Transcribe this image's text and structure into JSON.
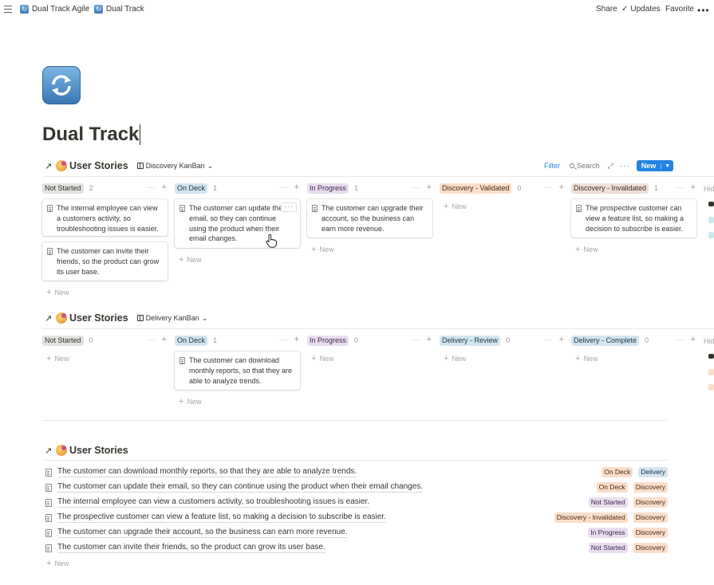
{
  "topbar": {
    "breadcrumb": [
      "Dual Track Agile",
      "Dual Track"
    ],
    "separator": "/",
    "share": "Share",
    "updates": "Updates",
    "favorite": "Favorite",
    "more": "•••"
  },
  "page": {
    "icon": "repeat-arrows-icon",
    "title": "Dual Track"
  },
  "discovery_board": {
    "section_title": "User Stories",
    "view_name": "Discovery KanBan",
    "toolbar": {
      "filter": "Filter",
      "search": "Search",
      "new": "New"
    },
    "columns": [
      {
        "label": "Not Started",
        "count": "2",
        "color": "gray",
        "cards": [
          "The internal employee can view a customers activity, so troubleshooting issues is easier.",
          "The customer can invite their friends, so the product can grow its user base."
        ]
      },
      {
        "label": "On Deck",
        "count": "1",
        "color": "blue",
        "cards": [
          "The customer can update their email, so they can continue using the product when their email changes."
        ]
      },
      {
        "label": "In Progress",
        "count": "1",
        "color": "purple",
        "cards": [
          "The customer can upgrade their account, so the business can earn more revenue."
        ]
      },
      {
        "label": "Discovery - Validated",
        "count": "0",
        "color": "orange",
        "cards": []
      },
      {
        "label": "Discovery - Invalidated",
        "count": "1",
        "color": "brown",
        "cards": [
          "The prospective customer can view a feature list, so making a decision to subscribe is easier."
        ]
      }
    ],
    "hidden_label": "Hid",
    "new_label": "New"
  },
  "delivery_board": {
    "section_title": "User Stories",
    "view_name": "Delivery KanBan",
    "columns": [
      {
        "label": "Not Started",
        "count": "0",
        "color": "gray",
        "cards": []
      },
      {
        "label": "On Deck",
        "count": "1",
        "color": "blue",
        "cards": [
          "The customer can download monthly reports, so that they are able to analyze trends."
        ]
      },
      {
        "label": "In Progress",
        "count": "0",
        "color": "purple",
        "cards": []
      },
      {
        "label": "Delivery - Review",
        "count": "0",
        "color": "blue",
        "cards": []
      },
      {
        "label": "Delivery - Complete",
        "count": "0",
        "color": "blue",
        "cards": []
      }
    ],
    "new_label": "New"
  },
  "list_view": {
    "section_title": "User Stories",
    "rows": [
      {
        "title": "The customer can download monthly reports, so that they are able to analyze trends.",
        "status": "On Deck",
        "status_color": "blue",
        "track": "Delivery",
        "track_color": "blue"
      },
      {
        "title": "The customer can update their email, so they can continue using the product when their email changes.",
        "status": "On Deck",
        "status_color": "orange",
        "track": "Discovery",
        "track_color": "orange"
      },
      {
        "title": "The internal employee can view a customers activity, so troubleshooting issues is easier.",
        "status": "Not Started",
        "status_color": "purple",
        "track": "Discovery",
        "track_color": "orange"
      },
      {
        "title": "The prospective customer can view a feature list, so making a decision to subscribe is easier.",
        "status": "Discovery - Invalidated",
        "status_color": "orange",
        "track": "Discovery",
        "track_color": "orange"
      },
      {
        "title": "The customer can upgrade their account, so the business can earn more revenue.",
        "status": "In Progress",
        "status_color": "purple",
        "track": "Discovery",
        "track_color": "orange"
      },
      {
        "title": "The customer can invite their friends, so the product can grow its user base.",
        "status": "Not Started",
        "status_color": "purple",
        "track": "Discovery",
        "track_color": "orange"
      }
    ],
    "new_label": "New"
  },
  "colors": {
    "accent": "#2383e2",
    "text": "#37352f",
    "muted": "#9b9a97"
  }
}
